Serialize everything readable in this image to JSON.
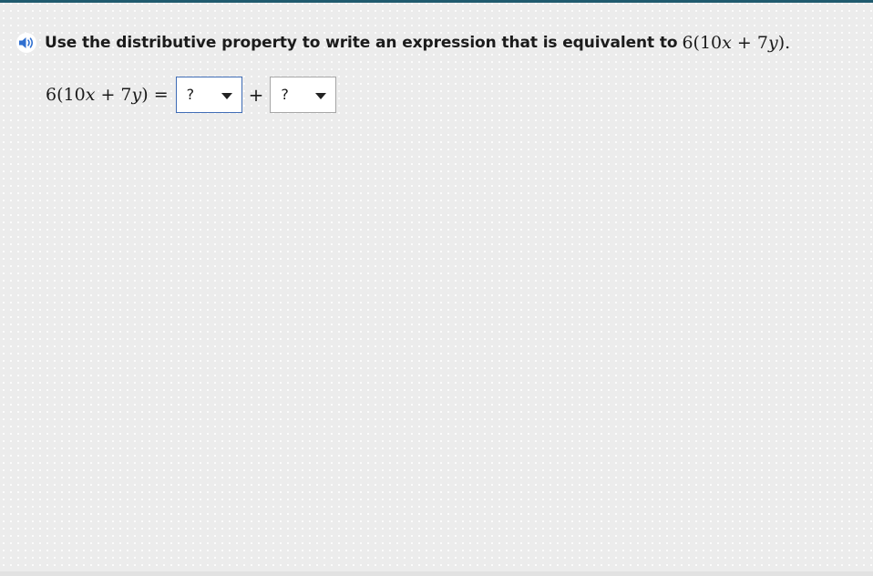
{
  "prompt": {
    "speaker_icon": "speaker-icon",
    "text": "Use the distributive property to write an expression that is equivalent to",
    "math": {
      "coef": "6",
      "open": "(",
      "num": "10",
      "var1": "x",
      "op": " + ",
      "num2": "7",
      "var2": "y",
      "close": ")",
      "end": "."
    }
  },
  "equation": {
    "lhs": {
      "coef": "6",
      "open": "(",
      "num": "10",
      "var1": "x",
      "op": " + ",
      "num2": "7",
      "var2": "y",
      "close": ")",
      "equals": " ="
    },
    "dropdown_1": {
      "selected": "?",
      "caret_icon": "caret-down-icon"
    },
    "plus": "+",
    "dropdown_2": {
      "selected": "?",
      "caret_icon": "caret-down-icon"
    }
  },
  "colors": {
    "top_bar": "#1f5a6e",
    "speaker": "#2f6fd0",
    "focused_border": "#3f6cb5",
    "background": "#ececec"
  }
}
